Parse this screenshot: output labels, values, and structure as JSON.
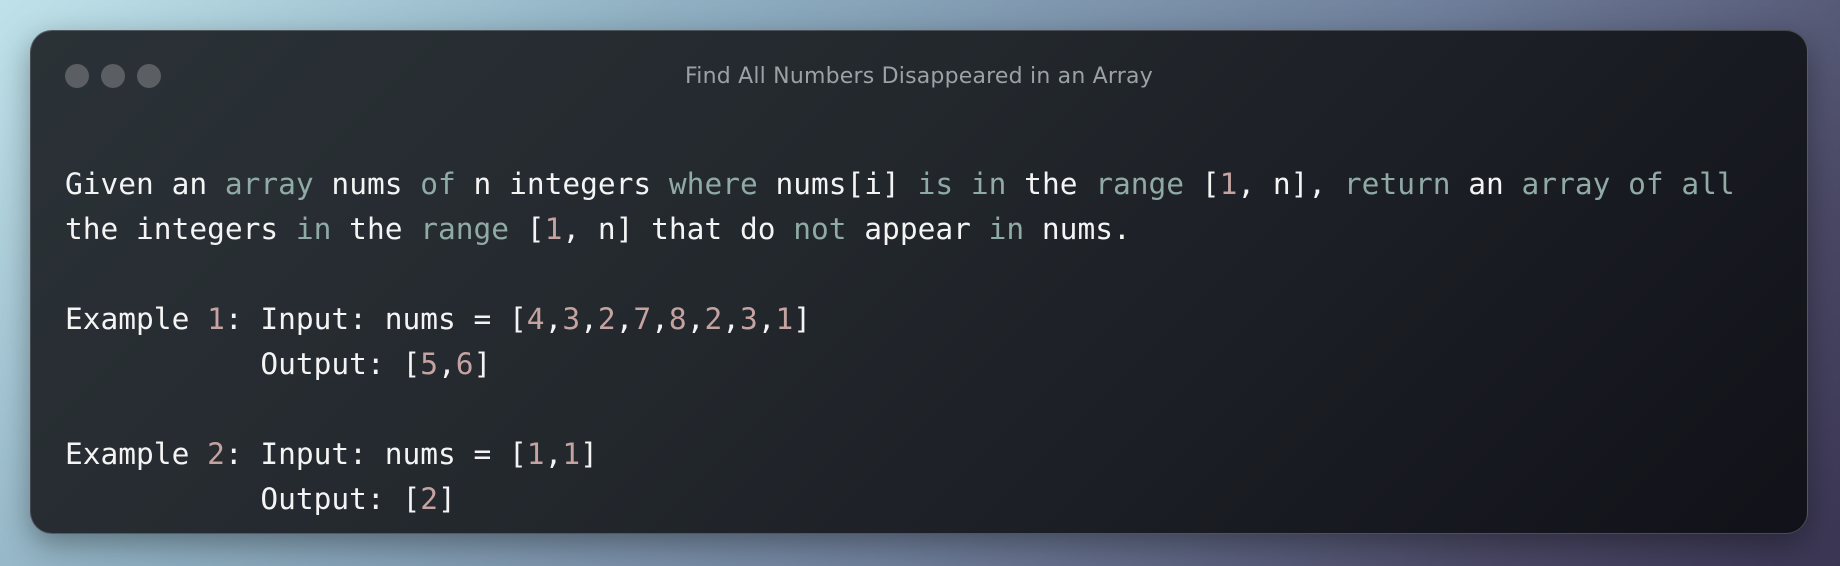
{
  "window": {
    "title": "Find All Numbers Disappeared in an Array",
    "buttons": [
      "close",
      "minimize",
      "maximize"
    ]
  },
  "colors": {
    "text": "#f4f4f4",
    "keyword": "#90aaa5",
    "number": "#c4a3a1",
    "title": "#9aa1a7",
    "window_button": "#5b5e62"
  },
  "code": {
    "lines": [
      [
        {
          "t": "Given an ",
          "c": "pl"
        },
        {
          "t": "array",
          "c": "kw"
        },
        {
          "t": " nums ",
          "c": "pl"
        },
        {
          "t": "of",
          "c": "kw"
        },
        {
          "t": " n integers ",
          "c": "pl"
        },
        {
          "t": "where",
          "c": "kw"
        },
        {
          "t": " nums[i] ",
          "c": "pl"
        },
        {
          "t": "is",
          "c": "kw"
        },
        {
          "t": " ",
          "c": "pl"
        },
        {
          "t": "in",
          "c": "kw"
        },
        {
          "t": " the ",
          "c": "pl"
        },
        {
          "t": "range",
          "c": "kw"
        },
        {
          "t": " [",
          "c": "pl"
        },
        {
          "t": "1",
          "c": "num"
        },
        {
          "t": ", n], ",
          "c": "pl"
        },
        {
          "t": "return",
          "c": "kw"
        },
        {
          "t": " an ",
          "c": "pl"
        },
        {
          "t": "array",
          "c": "kw"
        },
        {
          "t": " ",
          "c": "pl"
        },
        {
          "t": "of",
          "c": "kw"
        },
        {
          "t": " ",
          "c": "pl"
        },
        {
          "t": "all",
          "c": "kw"
        }
      ],
      [
        {
          "t": "the integers ",
          "c": "pl"
        },
        {
          "t": "in",
          "c": "kw"
        },
        {
          "t": " the ",
          "c": "pl"
        },
        {
          "t": "range",
          "c": "kw"
        },
        {
          "t": " [",
          "c": "pl"
        },
        {
          "t": "1",
          "c": "num"
        },
        {
          "t": ", n] that do ",
          "c": "pl"
        },
        {
          "t": "not",
          "c": "kw"
        },
        {
          "t": " appear ",
          "c": "pl"
        },
        {
          "t": "in",
          "c": "kw"
        },
        {
          "t": " nums.",
          "c": "pl"
        }
      ],
      [],
      [
        {
          "t": "Example ",
          "c": "pl"
        },
        {
          "t": "1",
          "c": "num"
        },
        {
          "t": ": Input: nums = [",
          "c": "pl"
        },
        {
          "t": "4",
          "c": "num"
        },
        {
          "t": ",",
          "c": "pl"
        },
        {
          "t": "3",
          "c": "num"
        },
        {
          "t": ",",
          "c": "pl"
        },
        {
          "t": "2",
          "c": "num"
        },
        {
          "t": ",",
          "c": "pl"
        },
        {
          "t": "7",
          "c": "num"
        },
        {
          "t": ",",
          "c": "pl"
        },
        {
          "t": "8",
          "c": "num"
        },
        {
          "t": ",",
          "c": "pl"
        },
        {
          "t": "2",
          "c": "num"
        },
        {
          "t": ",",
          "c": "pl"
        },
        {
          "t": "3",
          "c": "num"
        },
        {
          "t": ",",
          "c": "pl"
        },
        {
          "t": "1",
          "c": "num"
        },
        {
          "t": "]",
          "c": "pl"
        }
      ],
      [
        {
          "t": "           Output: [",
          "c": "pl"
        },
        {
          "t": "5",
          "c": "num"
        },
        {
          "t": ",",
          "c": "pl"
        },
        {
          "t": "6",
          "c": "num"
        },
        {
          "t": "]",
          "c": "pl"
        }
      ],
      [],
      [
        {
          "t": "Example ",
          "c": "pl"
        },
        {
          "t": "2",
          "c": "num"
        },
        {
          "t": ": Input: nums = [",
          "c": "pl"
        },
        {
          "t": "1",
          "c": "num"
        },
        {
          "t": ",",
          "c": "pl"
        },
        {
          "t": "1",
          "c": "num"
        },
        {
          "t": "]",
          "c": "pl"
        }
      ],
      [
        {
          "t": "           Output: [",
          "c": "pl"
        },
        {
          "t": "2",
          "c": "num"
        },
        {
          "t": "]",
          "c": "pl"
        }
      ]
    ]
  }
}
